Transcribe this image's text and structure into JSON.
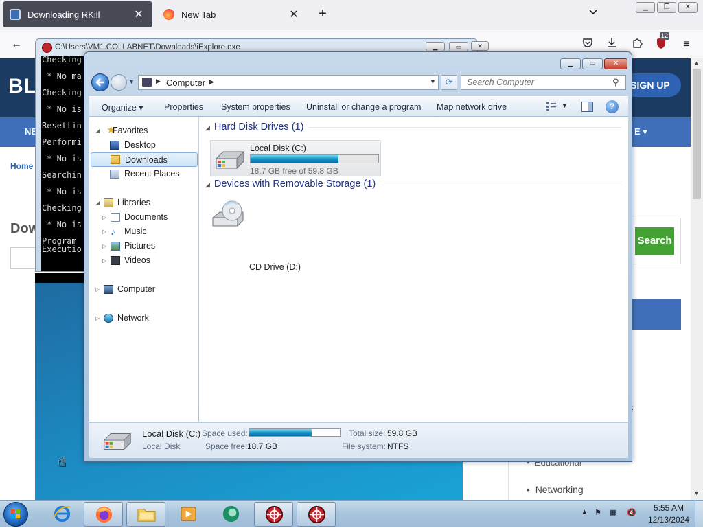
{
  "browser": {
    "tabs": [
      {
        "title": "Downloading RKill",
        "active": true
      },
      {
        "title": "New Tab",
        "active": false
      }
    ],
    "new_tab_symbol": "+",
    "tab_list_symbol": "⌄",
    "close_symbol": "✕",
    "back_symbol": "←",
    "extension_badge": "12",
    "menu_symbol": "≡"
  },
  "website": {
    "logo": "BL",
    "signup_label": "SIGN UP",
    "nav_left": "NE",
    "nav_right": "E ▾",
    "breadcrumb_home": "Home",
    "heading": "Dow",
    "search_label": "Search",
    "sidebar_fragment": "s",
    "sidebar_educational": "Educational",
    "sidebar_networking": "Networking"
  },
  "console": {
    "title": "C:\\Users\\VM1.COLLABNET\\Downloads\\iExplore.exe",
    "lines": [
      "Checking",
      "",
      " * No ma",
      "",
      "Checking",
      "",
      " * No is",
      "",
      "Resettin",
      "",
      "Performi",
      "",
      " * No is",
      "",
      "Searchin",
      "",
      " * No is",
      "",
      "Checking",
      "",
      " * No is",
      "",
      "Program ",
      "Executio"
    ]
  },
  "explorer": {
    "controls": {
      "minimize": "▁",
      "maximize": "▭",
      "close": "✕"
    },
    "address": {
      "location": "Computer"
    },
    "search": {
      "placeholder": "Search Computer"
    },
    "commands": [
      {
        "label": "Organize ▾"
      },
      {
        "label": "Properties"
      },
      {
        "label": "System properties"
      },
      {
        "label": "Uninstall or change a program"
      },
      {
        "label": "Map network drive"
      }
    ],
    "nav": {
      "favorites": "Favorites",
      "desktop": "Desktop",
      "downloads": "Downloads",
      "recent": "Recent Places",
      "libraries": "Libraries",
      "documents": "Documents",
      "music": "Music",
      "pictures": "Pictures",
      "videos": "Videos",
      "computer": "Computer",
      "network": "Network"
    },
    "groups": {
      "hard_disks": "Hard Disk Drives (1)",
      "removable": "Devices with Removable Storage (1)"
    },
    "drives": {
      "c": {
        "name": "Local Disk (C:)",
        "free_text": "18.7 GB free of 59.8 GB",
        "used_fraction": 0.687
      },
      "d": {
        "name": "CD Drive (D:)"
      }
    },
    "details": {
      "name": "Local Disk (C:)",
      "type": "Local Disk",
      "space_used_label": "Space used:",
      "space_free_label": "Space free:",
      "space_free_value": "18.7 GB",
      "total_size_label": "Total size:",
      "total_size_value": "59.8 GB",
      "file_system_label": "File system:",
      "file_system_value": "NTFS"
    }
  },
  "taskbar": {
    "time": "5:55 AM",
    "date": "12/13/2024"
  }
}
